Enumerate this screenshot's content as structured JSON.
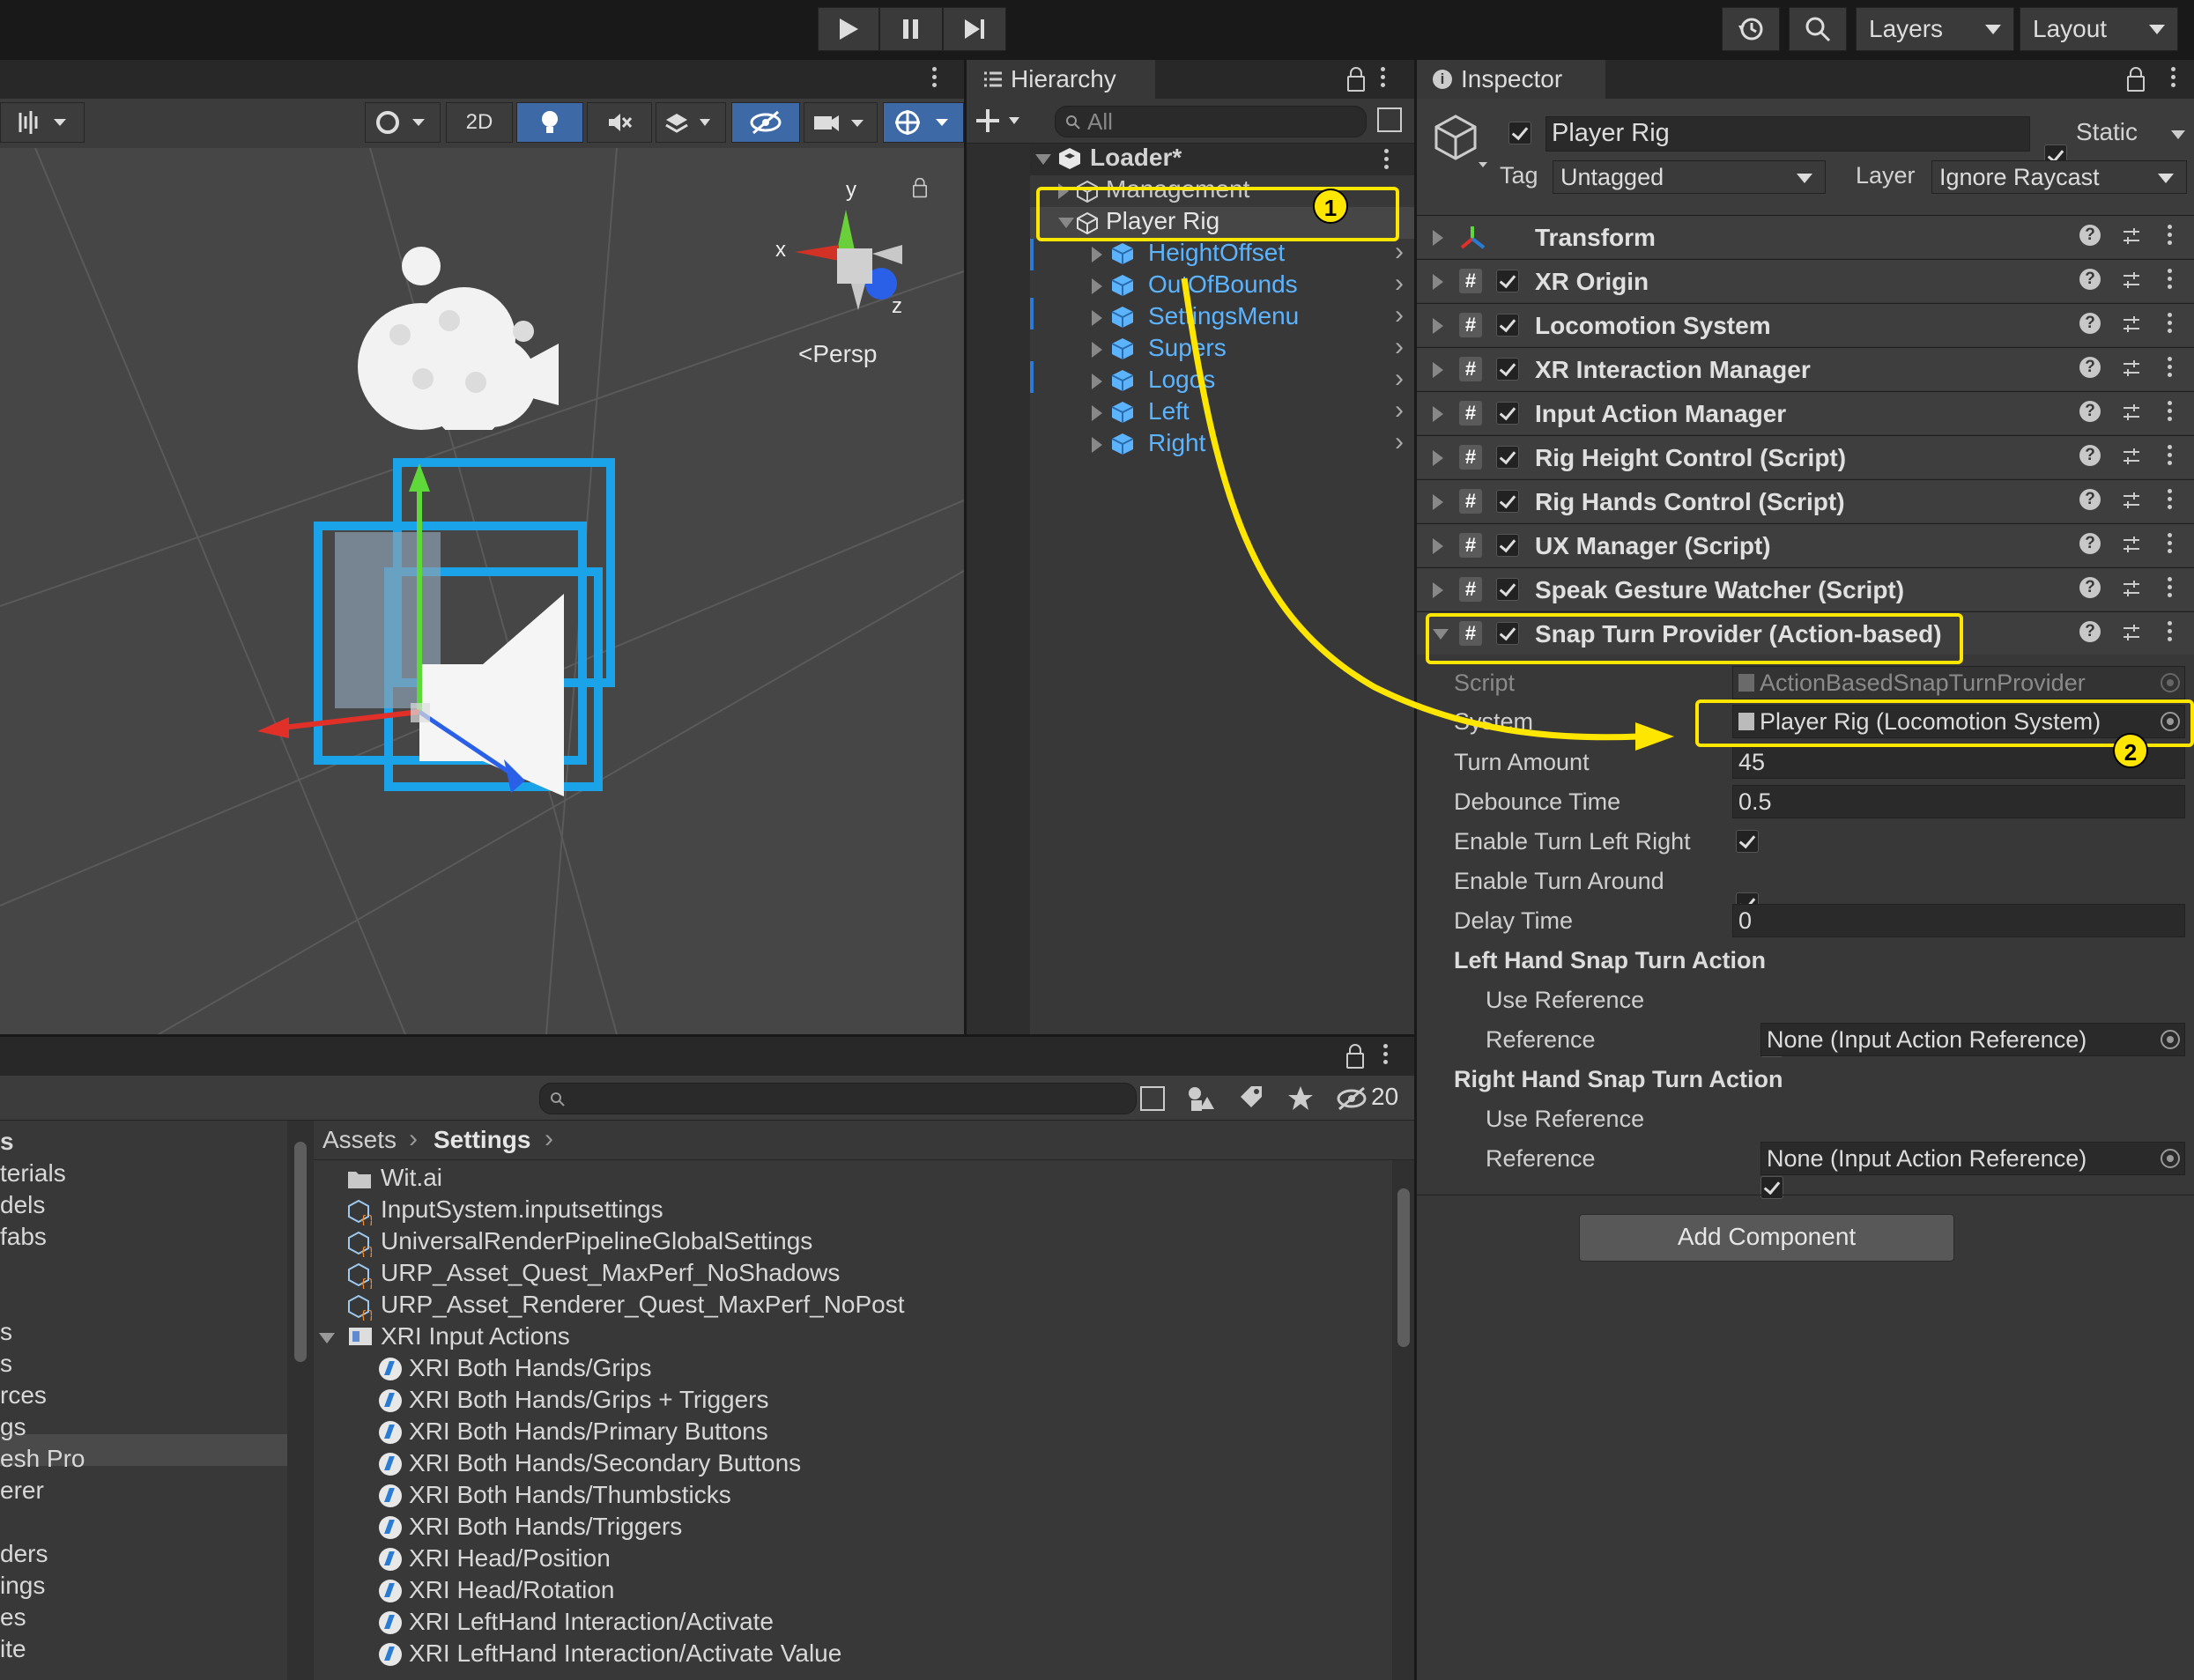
{
  "toolbar": {
    "layers_label": "Layers",
    "layout_label": "Layout"
  },
  "scene": {
    "btn_2d": "2D",
    "persp_label": "Persp",
    "gizmo_y": "y",
    "gizmo_x": "x",
    "gizmo_z": "z"
  },
  "hierarchy": {
    "tab_label": "Hierarchy",
    "search_placeholder": "All",
    "items": [
      {
        "label": "Loader*"
      },
      {
        "label": "Management"
      },
      {
        "label": "Player Rig"
      },
      {
        "label": "HeightOffset"
      },
      {
        "label": "OutOfBounds"
      },
      {
        "label": "SettingsMenu"
      },
      {
        "label": "Supers"
      },
      {
        "label": "Logos"
      },
      {
        "label": "Left"
      },
      {
        "label": "Right"
      }
    ]
  },
  "inspector": {
    "tab_label": "Inspector",
    "object_name": "Player Rig",
    "static_label": "Static",
    "tag_label": "Tag",
    "tag_value": "Untagged",
    "layer_label": "Layer",
    "layer_value": "Ignore Raycast",
    "components": [
      {
        "label": "Transform"
      },
      {
        "label": "XR Origin"
      },
      {
        "label": "Locomotion System"
      },
      {
        "label": "XR Interaction Manager"
      },
      {
        "label": "Input Action Manager"
      },
      {
        "label": "Rig Height Control (Script)"
      },
      {
        "label": "Rig Hands Control (Script)"
      },
      {
        "label": "UX Manager (Script)"
      },
      {
        "label": "Speak Gesture Watcher (Script)"
      },
      {
        "label": "Snap Turn Provider (Action-based)"
      }
    ],
    "props": {
      "script_label": "Script",
      "script_value": "ActionBasedSnapTurnProvider",
      "system_label": "System",
      "system_value": "Player Rig (Locomotion System)",
      "turn_amount_label": "Turn Amount",
      "turn_amount_value": "45",
      "debounce_label": "Debounce Time",
      "debounce_value": "0.5",
      "enable_lr_label": "Enable Turn Left Right",
      "enable_around_label": "Enable Turn Around",
      "delay_label": "Delay Time",
      "delay_value": "0",
      "left_header": "Left Hand Snap Turn Action",
      "right_header": "Right Hand Snap Turn Action",
      "use_reference_label": "Use Reference",
      "reference_label": "Reference",
      "reference_value": "None (Input Action Reference)"
    },
    "add_component": "Add Component"
  },
  "annotations": {
    "badge1": "1",
    "badge2": "2"
  },
  "project": {
    "hidden_count": "20",
    "breadcrumb_root": "Assets",
    "breadcrumb_current": "Settings",
    "left_items": [
      "s",
      "terials",
      "dels",
      "fabs",
      "s",
      "s",
      "rces",
      "gs",
      "esh Pro",
      "erer",
      "ders",
      "ings",
      "es",
      "ite"
    ],
    "assets": [
      {
        "label": "Wit.ai",
        "icon": "folder-icon"
      },
      {
        "label": "InputSystem.inputsettings",
        "icon": "asset-icon"
      },
      {
        "label": "UniversalRenderPipelineGlobalSettings",
        "icon": "asset-icon"
      },
      {
        "label": "URP_Asset_Quest_MaxPerf_NoShadows",
        "icon": "asset-icon"
      },
      {
        "label": "URP_Asset_Renderer_Quest_MaxPerf_NoPost",
        "icon": "asset-icon"
      },
      {
        "label": "XRI Input Actions",
        "icon": "input-actions-icon"
      },
      {
        "label": "XRI Both Hands/Grips",
        "icon": "bolt-icon"
      },
      {
        "label": "XRI Both Hands/Grips + Triggers",
        "icon": "bolt-icon"
      },
      {
        "label": "XRI Both Hands/Primary Buttons",
        "icon": "bolt-icon"
      },
      {
        "label": "XRI Both Hands/Secondary Buttons",
        "icon": "bolt-icon"
      },
      {
        "label": "XRI Both Hands/Thumbsticks",
        "icon": "bolt-icon"
      },
      {
        "label": "XRI Both Hands/Triggers",
        "icon": "bolt-icon"
      },
      {
        "label": "XRI Head/Position",
        "icon": "bolt-icon"
      },
      {
        "label": "XRI Head/Rotation",
        "icon": "bolt-icon"
      },
      {
        "label": "XRI LeftHand Interaction/Activate",
        "icon": "bolt-icon"
      },
      {
        "label": "XRI LeftHand Interaction/Activate Value",
        "icon": "bolt-icon"
      }
    ]
  },
  "colors": {
    "highlight": "#ffe600",
    "prefab_blue": "#5cb4ff",
    "panel_bg": "#383838"
  }
}
